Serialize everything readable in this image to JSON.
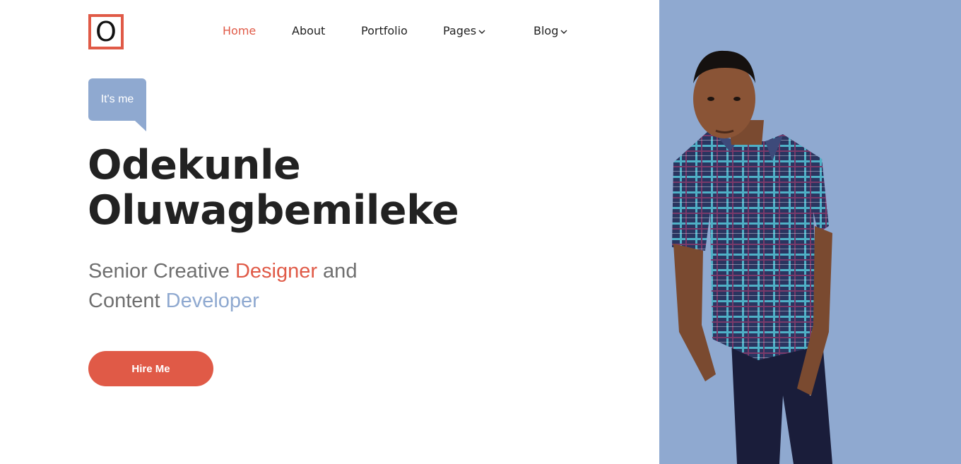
{
  "header": {
    "logo_letter": "O",
    "nav": [
      {
        "label": "Home",
        "active": true
      },
      {
        "label": "About",
        "active": false
      },
      {
        "label": "Portfolio",
        "active": false
      },
      {
        "label": "Pages",
        "active": false,
        "dropdown": true
      },
      {
        "label": "Blog",
        "active": false,
        "dropdown": true
      }
    ]
  },
  "hero": {
    "badge": "It's me",
    "name_line1": "Odekunle",
    "name_line2": "Oluwagbemileke",
    "subtitle": {
      "part1": "Senior Creative ",
      "highlight1": "Designer",
      "part2": " and",
      "part3": "Content ",
      "highlight2": "Developer"
    },
    "cta_label": "Hire Me"
  },
  "colors": {
    "accent": "#e05a47",
    "panel": "#8fa9d0",
    "text": "#222222",
    "muted": "#6f6f6f"
  }
}
